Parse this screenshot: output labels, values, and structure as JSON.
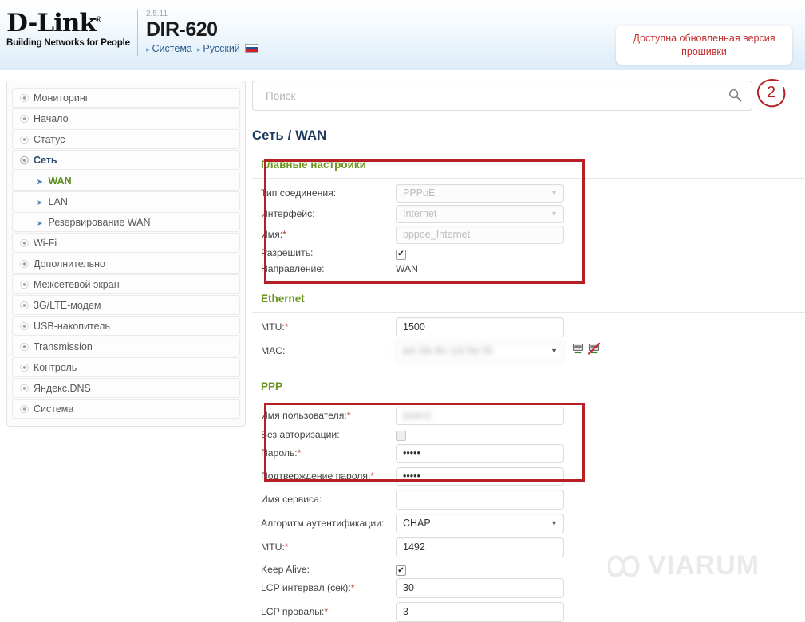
{
  "header": {
    "logo_main": "D-Link",
    "logo_registered": "®",
    "logo_tagline": "Building Networks for People",
    "firmware_version": "2.5.11",
    "model": "DIR-620",
    "link_system": "Система",
    "link_language": "Русский",
    "flag_icon": "russian-flag-icon"
  },
  "firmware_notice": {
    "text": "Доступна обновленная версия прошивки",
    "color": "#c2302e"
  },
  "annotation": {
    "marker_2": "2",
    "color": "#b81f24"
  },
  "sidebar": {
    "items": [
      {
        "label": "Мониторинг",
        "level": 0,
        "state": "normal"
      },
      {
        "label": "Начало",
        "level": 0,
        "state": "normal"
      },
      {
        "label": "Статус",
        "level": 0,
        "state": "normal"
      },
      {
        "label": "Сеть",
        "level": 0,
        "state": "expanded"
      },
      {
        "label": "WAN",
        "level": 1,
        "state": "current"
      },
      {
        "label": "LAN",
        "level": 1,
        "state": "normal"
      },
      {
        "label": "Резервирование WAN",
        "level": 1,
        "state": "normal"
      },
      {
        "label": "Wi-Fi",
        "level": 0,
        "state": "normal"
      },
      {
        "label": "Дополнительно",
        "level": 0,
        "state": "normal"
      },
      {
        "label": "Межсетевой экран",
        "level": 0,
        "state": "normal"
      },
      {
        "label": "3G/LTE-модем",
        "level": 0,
        "state": "normal"
      },
      {
        "label": "USB-накопитель",
        "level": 0,
        "state": "normal"
      },
      {
        "label": "Transmission",
        "level": 0,
        "state": "normal"
      },
      {
        "label": "Контроль",
        "level": 0,
        "state": "normal"
      },
      {
        "label": "Яндекс.DNS",
        "level": 0,
        "state": "normal"
      },
      {
        "label": "Система",
        "level": 0,
        "state": "normal"
      }
    ]
  },
  "search": {
    "placeholder": "Поиск",
    "value": "",
    "icon": "search-icon"
  },
  "breadcrumb": "Сеть /  WAN",
  "sections": {
    "main_settings": {
      "title": "Главные настройки",
      "highlighted": true,
      "fields": {
        "conn_type_label": "Тип соединения:",
        "conn_type_value": "PPPoE",
        "interface_label": "Интерфейс:",
        "interface_value": "Internet",
        "name_label": "Имя:",
        "name_value": "pppoe_Internet",
        "allow_label": "Разрешить:",
        "allow_checked": true,
        "direction_label": "Направление:",
        "direction_value": "WAN"
      }
    },
    "ethernet": {
      "title": "Ethernet",
      "fields": {
        "mtu_label": "MTU:",
        "mtu_value": "1500",
        "mac_label": "MAC:",
        "mac_value": "",
        "mac_redacted": true,
        "icon_clone_mac": "network-port-icon",
        "icon_reset_mac": "network-port-disabled-icon"
      }
    },
    "ppp": {
      "title": "PPP",
      "highlighted": true,
      "fields": {
        "username_label": "Имя пользователя:",
        "username_value": "",
        "username_redacted": true,
        "noauth_label": "Без авторизации:",
        "noauth_checked": false,
        "password_label": "Пароль:",
        "password_value": "•••••",
        "confirm_label": "Подтверждение пароля:",
        "confirm_value": "•••••",
        "service_label": "Имя сервиса:",
        "service_value": "",
        "auth_algo_label": "Алгоритм аутентификации:",
        "auth_algo_value": "CHAP",
        "mtu_label": "MTU:",
        "mtu_value": "1492",
        "keepalive_label": "Keep Alive:",
        "keepalive_checked": true,
        "lcp_interval_label": "LCP интервал (сек):",
        "lcp_interval_value": "30",
        "lcp_fail_label": "LCP провалы:",
        "lcp_fail_value": "3"
      }
    }
  },
  "watermark": {
    "text": "VIARUM",
    "logo": "infinity-logo-icon"
  }
}
